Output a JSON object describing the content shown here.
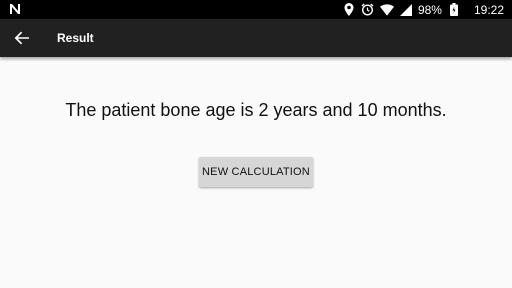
{
  "status_bar": {
    "notification_icon": "n-icon",
    "icons": [
      "location-icon",
      "alarm-icon",
      "wifi-icon",
      "signal-icon",
      "battery-icon"
    ],
    "battery": "98%",
    "time": "19:22"
  },
  "app_bar": {
    "back_icon": "arrow-back-icon",
    "title": "Result"
  },
  "main": {
    "result_text": "The patient bone age is 2 years and 10 months.",
    "new_calc_label": "NEW CALCULATION"
  }
}
